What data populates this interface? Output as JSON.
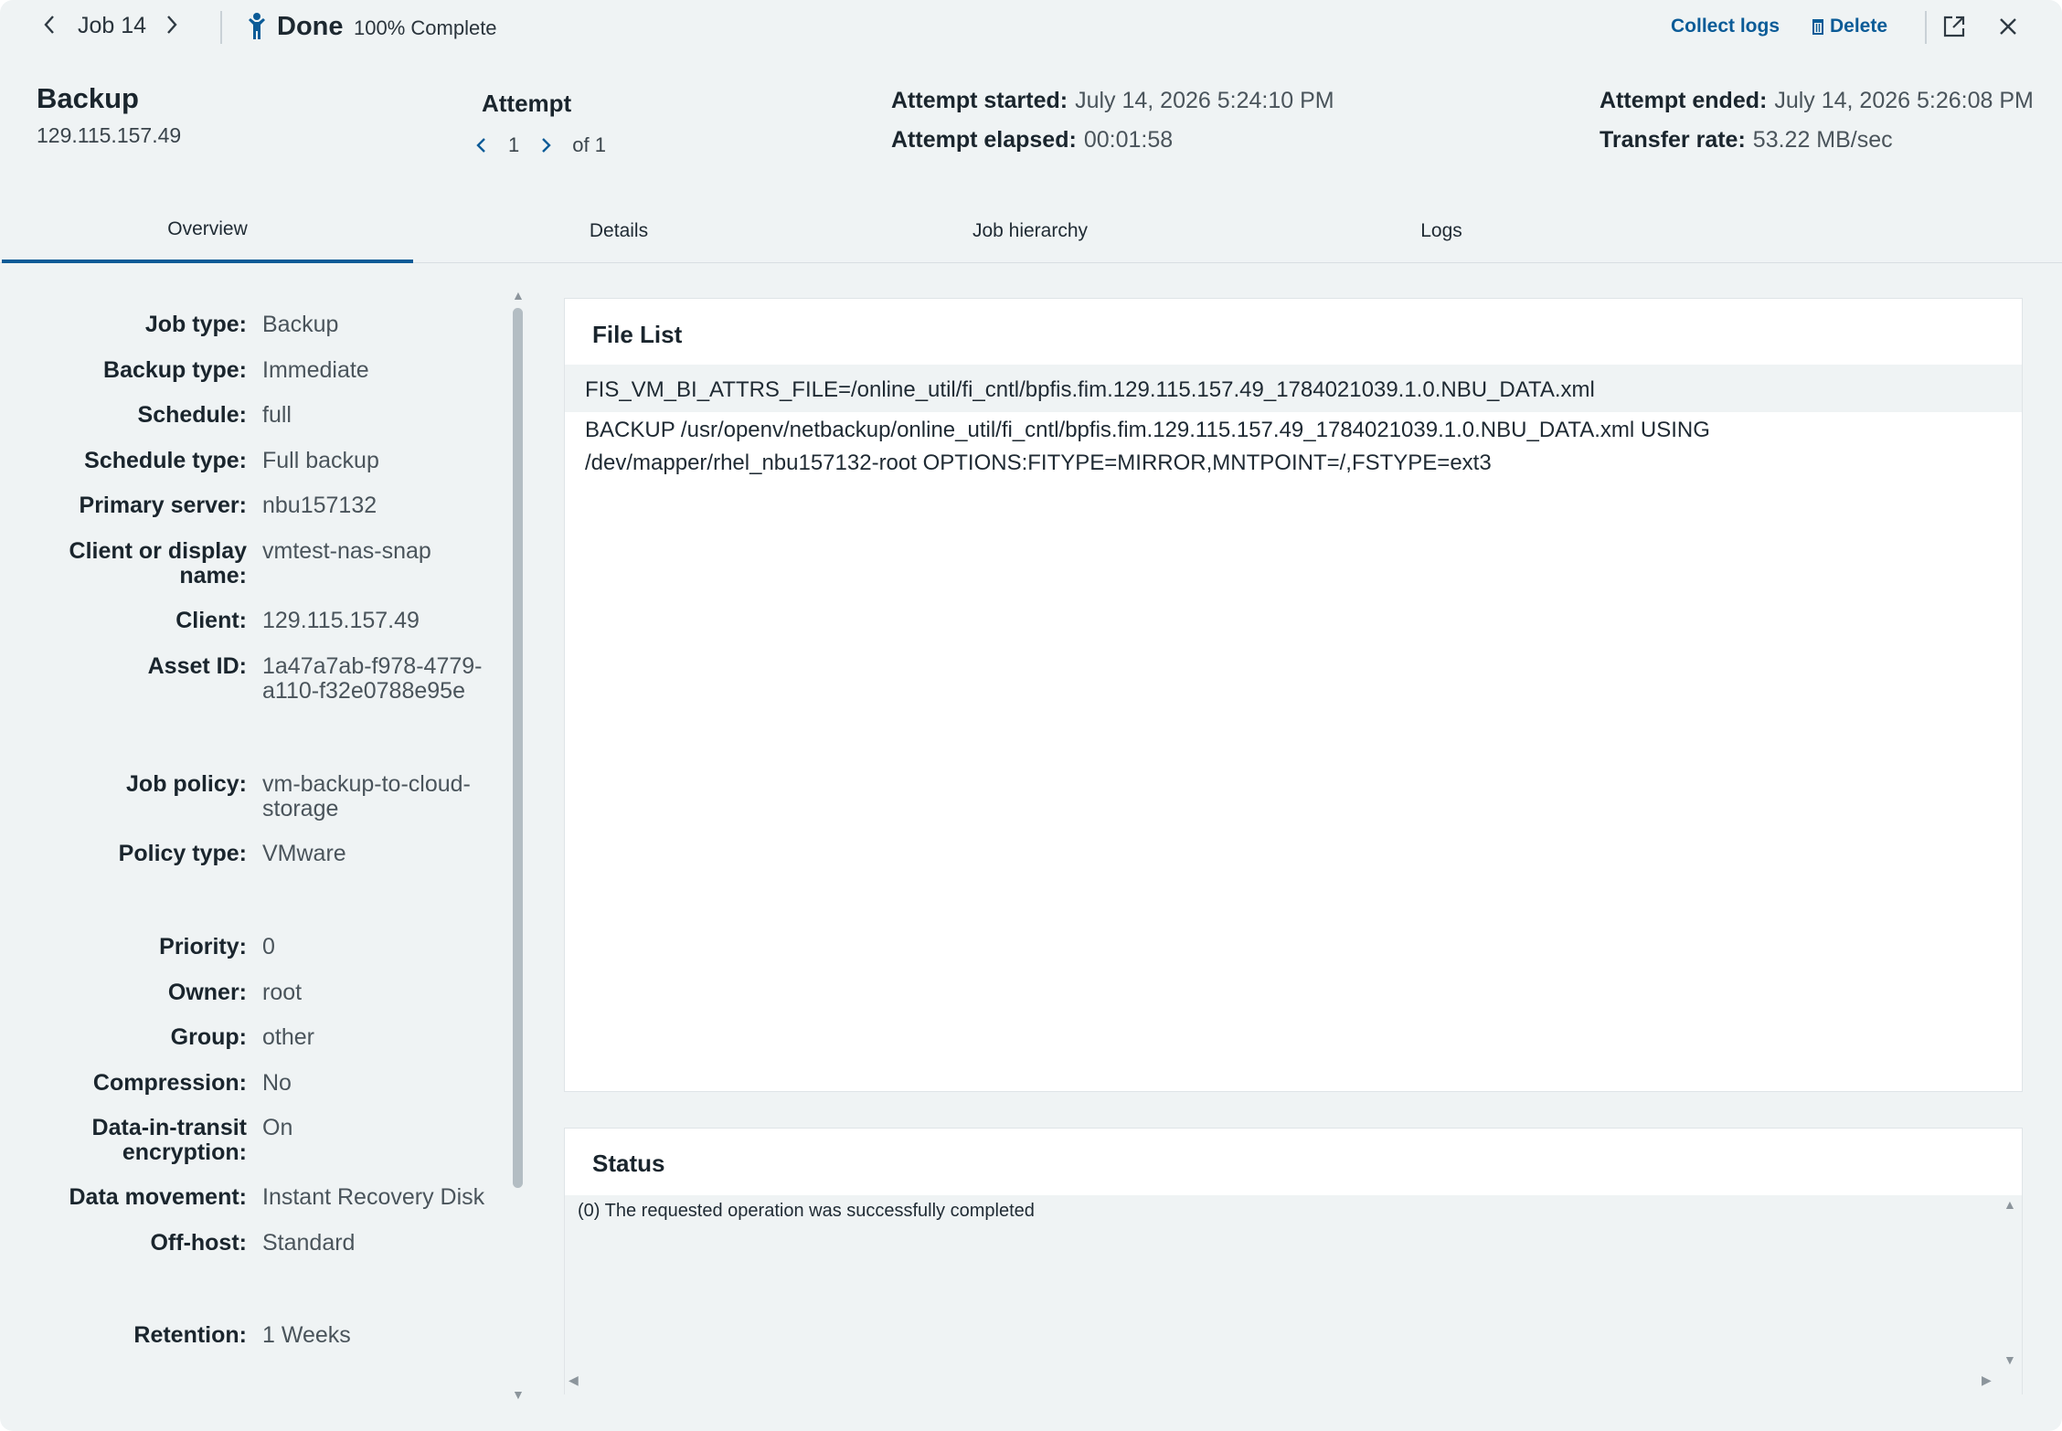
{
  "topbar": {
    "job_label": "Job 14",
    "done_label": "Done",
    "percent_label": "100% Complete",
    "collect_logs": "Collect logs",
    "delete": "Delete"
  },
  "header": {
    "title": "Backup",
    "subtitle": "129.115.157.49",
    "attempt_title": "Attempt",
    "attempt_current": "1",
    "attempt_of": "of 1",
    "attempt_started_label": "Attempt started:",
    "attempt_started_value": "July 14, 2026 5:24:10 PM",
    "attempt_elapsed_label": "Attempt elapsed:",
    "attempt_elapsed_value": "00:01:58",
    "attempt_ended_label": "Attempt ended:",
    "attempt_ended_value": "July 14, 2026 5:26:08 PM",
    "transfer_rate_label": "Transfer rate:",
    "transfer_rate_value": "53.22 MB/sec"
  },
  "tabs": [
    {
      "label": "Overview",
      "active": true
    },
    {
      "label": "Details",
      "active": false
    },
    {
      "label": "Job hierarchy",
      "active": false
    },
    {
      "label": "Logs",
      "active": false
    }
  ],
  "properties": [
    {
      "label": "Job type:",
      "value": "Backup"
    },
    {
      "label": "Backup type:",
      "value": "Immediate"
    },
    {
      "label": "Schedule:",
      "value": "full"
    },
    {
      "label": "Schedule type:",
      "value": "Full backup"
    },
    {
      "label": "Primary server:",
      "value": "nbu157132"
    },
    {
      "label": "Client or display name:",
      "value": "vmtest-nas-snap"
    },
    {
      "label": "Client:",
      "value": "129.115.157.49"
    },
    {
      "label": "Asset ID:",
      "value": "1a47a7ab-f978-4779-a110-f32e0788e95e"
    },
    {
      "label": "Job policy:",
      "value": "vm-backup-to-cloud-storage"
    },
    {
      "label": "Policy type:",
      "value": "VMware"
    },
    {
      "label": "Priority:",
      "value": "0"
    },
    {
      "label": "Owner:",
      "value": "root"
    },
    {
      "label": "Group:",
      "value": "other"
    },
    {
      "label": "Compression:",
      "value": "No"
    },
    {
      "label": "Data-in-transit encryption:",
      "value": "On"
    },
    {
      "label": "Data movement:",
      "value": "Instant Recovery Disk"
    },
    {
      "label": "Off-host:",
      "value": "Standard"
    },
    {
      "label": "Retention:",
      "value": "1 Weeks"
    }
  ],
  "file_list": {
    "title": "File List",
    "rows": [
      "FIS_VM_BI_ATTRS_FILE=/online_util/fi_cntl/bpfis.fim.129.115.157.49_1784021039.1.0.NBU_DATA.xml",
      "BACKUP /usr/openv/netbackup/online_util/fi_cntl/bpfis.fim.129.115.157.49_1784021039.1.0.NBU_DATA.xml USING /dev/mapper/rhel_nbu157132-root OPTIONS:FITYPE=MIRROR,MNTPOINT=/,FSTYPE=ext3"
    ]
  },
  "status": {
    "title": "Status",
    "text": "(0) The requested operation was successfully completed"
  },
  "colors": {
    "accent": "#0b5b97",
    "background": "#eff3f4",
    "card": "#ffffff"
  }
}
